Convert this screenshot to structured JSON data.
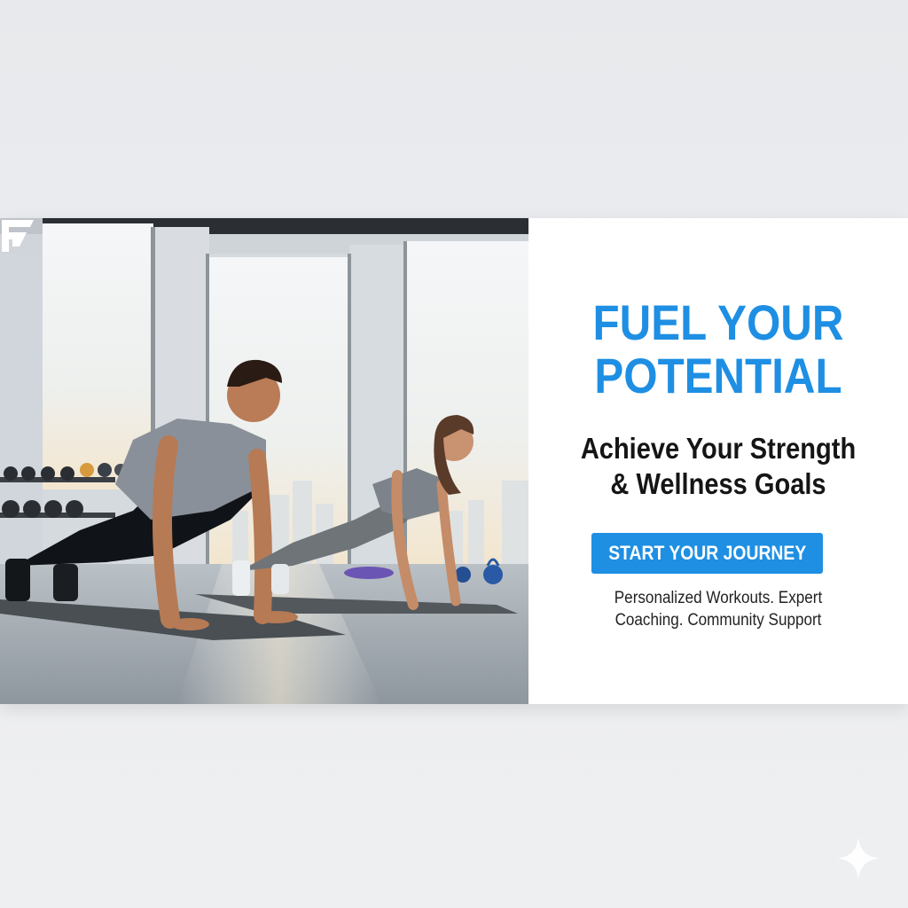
{
  "banner": {
    "headline_line1": "FUEL YOUR",
    "headline_line2": "POTENTIAL",
    "subhead_line1": "Achieve Your Strength",
    "subhead_line2": "& Wellness Goals",
    "cta_label": "START YOUR JOURNEY",
    "features_line1": "Personalized Workouts. Expert",
    "features_line2": "Coaching. Community Support"
  },
  "photo": {
    "subject": "man-and-woman-doing-push-ups-in-gym"
  },
  "icons": {
    "logo": "f-logo-icon",
    "sparkle": "sparkle-icon"
  },
  "colors": {
    "accent": "#1e8fe3",
    "heading_text": "#151515",
    "panel_background": "#ffffff",
    "page_background": "#eceef0"
  }
}
